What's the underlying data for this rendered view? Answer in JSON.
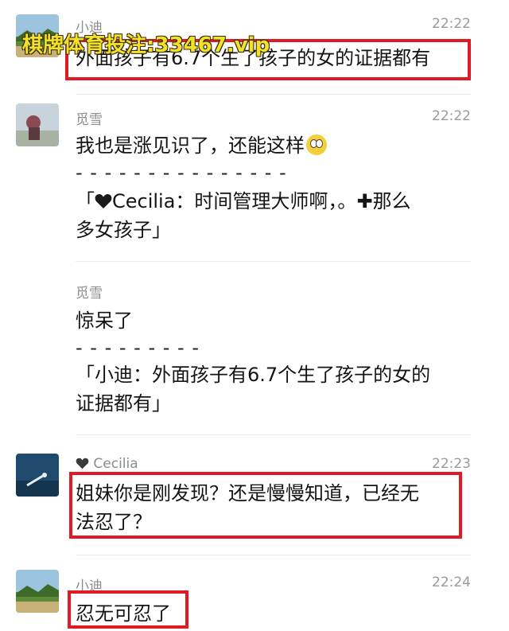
{
  "watermark": "棋牌体育投注:33467.vip",
  "messages": [
    {
      "name": "小迪",
      "time": "22:22",
      "lines": [
        "外面孩子有6.7个生了孩子的女的证据都有"
      ]
    },
    {
      "name": "觅雪",
      "time": "22:22",
      "line1": "我也是涨见识了，还能这样",
      "emoji": "surprised-face-icon",
      "dash": "- - - - - - - - - - - - - - -",
      "quote_prefix": "「",
      "quote_name": "Cecilia：时间管理大师啊，。",
      "quote_tail": "那么",
      "quote_line2": "多女孩子」"
    },
    {
      "name": "觅雪",
      "line1": "惊呆了",
      "dash": "- - - - - - - - -",
      "quote_line1": "「小迪：外面孩子有6.7个生了孩子的女的",
      "quote_line2": "证据都有」"
    },
    {
      "name": "Cecilia",
      "time": "22:23",
      "line1": "姐妹你是刚发现？还是慢慢知道，已经无",
      "line2": "法忍了？"
    },
    {
      "name": "小迪",
      "time": "22:24",
      "line1": "忍无可忍了"
    }
  ],
  "colors": {
    "highlight": "#e01b24",
    "watermark": "#f0e12a"
  }
}
